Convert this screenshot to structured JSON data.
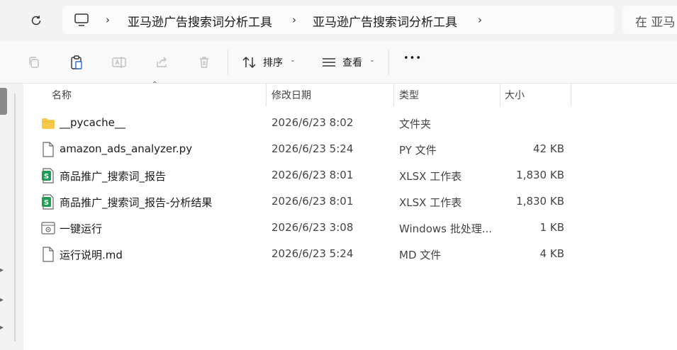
{
  "address_bar": {
    "breadcrumbs": [
      "亚马逊广告搜索词分析工具",
      "亚马逊广告搜索词分析工具"
    ],
    "search_placeholder": "在 亚马"
  },
  "toolbar": {
    "sort_label": "排序",
    "view_label": "查看",
    "more_label": "•••"
  },
  "columns": {
    "name": "名称",
    "date": "修改日期",
    "type": "类型",
    "size": "大小"
  },
  "files": [
    {
      "name": "__pycache__",
      "date": "2026/6/23 8:02",
      "type": "文件夹",
      "size": "",
      "icon": "folder-icon"
    },
    {
      "name": "amazon_ads_analyzer.py",
      "date": "2026/6/23 5:24",
      "type": "PY 文件",
      "size": "42 KB",
      "icon": "document-icon"
    },
    {
      "name": "商品推广_搜索词_报告",
      "date": "2026/6/23 8:01",
      "type": "XLSX 工作表",
      "size": "1,830 KB",
      "icon": "spreadsheet-icon"
    },
    {
      "name": "商品推广_搜索词_报告-分析结果",
      "date": "2026/6/23 8:01",
      "type": "XLSX 工作表",
      "size": "1,830 KB",
      "icon": "spreadsheet-icon"
    },
    {
      "name": "一键运行",
      "date": "2026/6/23 3:08",
      "type": "Windows 批处理...",
      "size": "1 KB",
      "icon": "batch-file-icon"
    },
    {
      "name": "运行说明.md",
      "date": "2026/6/23 5:24",
      "type": "MD 文件",
      "size": "4 KB",
      "icon": "document-icon"
    }
  ],
  "colors": {
    "folder": "#f8c94a",
    "spreadsheet": "#1f9d55",
    "chrome_bg": "#f3f3f3"
  }
}
